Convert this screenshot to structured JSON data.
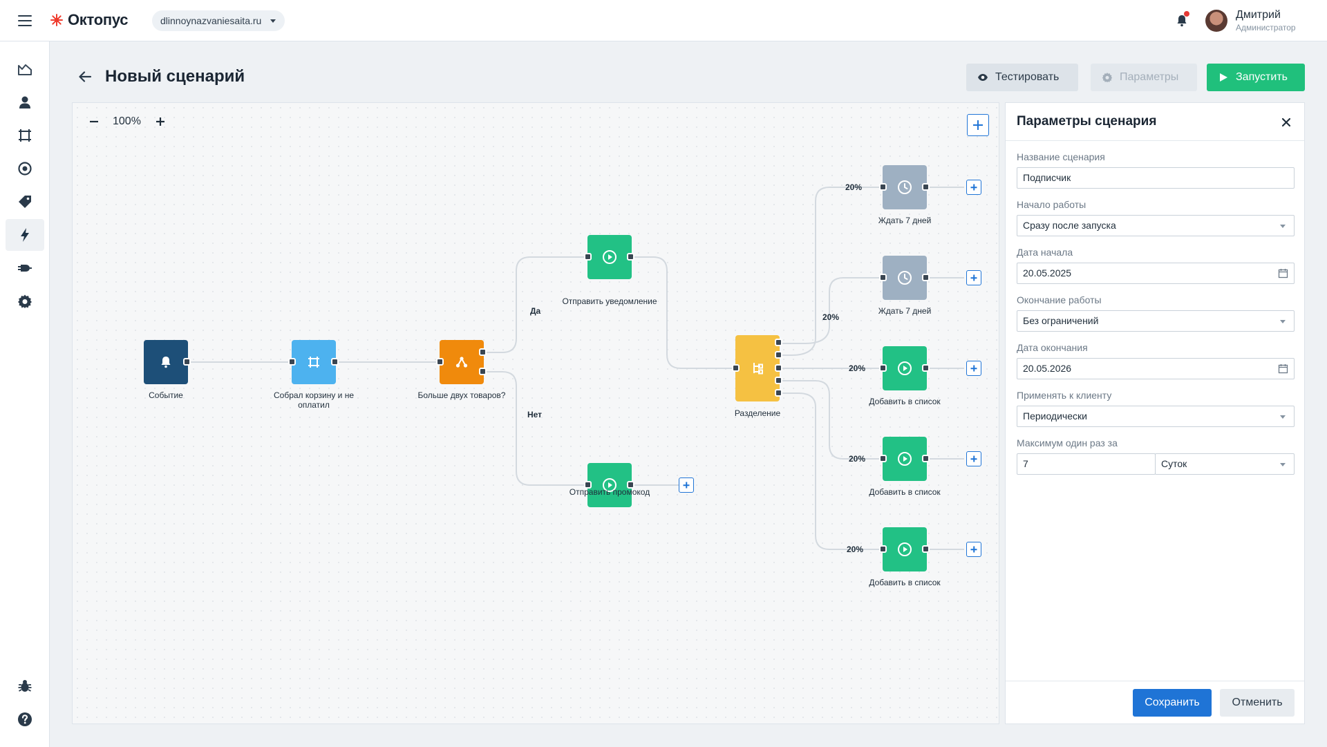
{
  "app": {
    "brand": "Октопус",
    "site": "dlinnoynazvaniesaita.ru"
  },
  "user": {
    "name": "Дмитрий",
    "role": "Администратор"
  },
  "sidebar": {
    "items": [
      {
        "icon": "chart-icon"
      },
      {
        "icon": "user-icon"
      },
      {
        "icon": "frame-icon"
      },
      {
        "icon": "target-icon"
      },
      {
        "icon": "tag-icon"
      },
      {
        "icon": "lightning-icon",
        "active": true
      },
      {
        "icon": "plug-icon"
      },
      {
        "icon": "gear-icon"
      }
    ],
    "bottom": [
      {
        "icon": "bug-icon"
      },
      {
        "icon": "help-icon"
      }
    ]
  },
  "page": {
    "title": "Новый сценарий",
    "buttons": {
      "test": "Тестировать",
      "params": "Параметры",
      "run": "Запустить"
    }
  },
  "canvas": {
    "zoom": "100%",
    "nodes": {
      "event": "Событие",
      "cart": "Собрал корзину и не оплатил",
      "condition": "Больше двух товаров?",
      "notify": "Отправить уведомление",
      "promo": "Отправить промокод",
      "split": "Разделение",
      "wait1": "Ждать  7 дней",
      "wait2": "Ждать  7 дней",
      "add1": "Добавить в список",
      "add2": "Добавить в список",
      "add3": "Добавить в список"
    },
    "edge_labels": {
      "yes": "Да",
      "no": "Нет",
      "p1": "20%",
      "p2": "20%",
      "p3": "20%",
      "p4": "20%",
      "p5": "20%"
    }
  },
  "colors": {
    "accent": "#1f74d6",
    "run": "#20c07c",
    "event": "#1d4f78",
    "cart": "#4db2ef",
    "condition": "#f08a0c",
    "action": "#22c185",
    "split": "#f5c142",
    "wait": "#9eb0c2"
  },
  "panel": {
    "title": "Параметры сценария",
    "fields": {
      "name_label": "Название сценария",
      "name_value": "Подписчик",
      "start_label": "Начало работы",
      "start_value": "Сразу после запуска",
      "start_date_label": "Дата начала",
      "start_date_value": "20.05.2025",
      "end_label": "Окончание работы",
      "end_value": "Без ограничений",
      "end_date_label": "Дата окончания",
      "end_date_value": "20.05.2026",
      "apply_label": "Применять к клиенту",
      "apply_value": "Периодически",
      "max_label": "Максимум один раз за",
      "max_value": "7",
      "max_unit": "Суток"
    },
    "save": "Сохранить",
    "cancel": "Отменить"
  }
}
